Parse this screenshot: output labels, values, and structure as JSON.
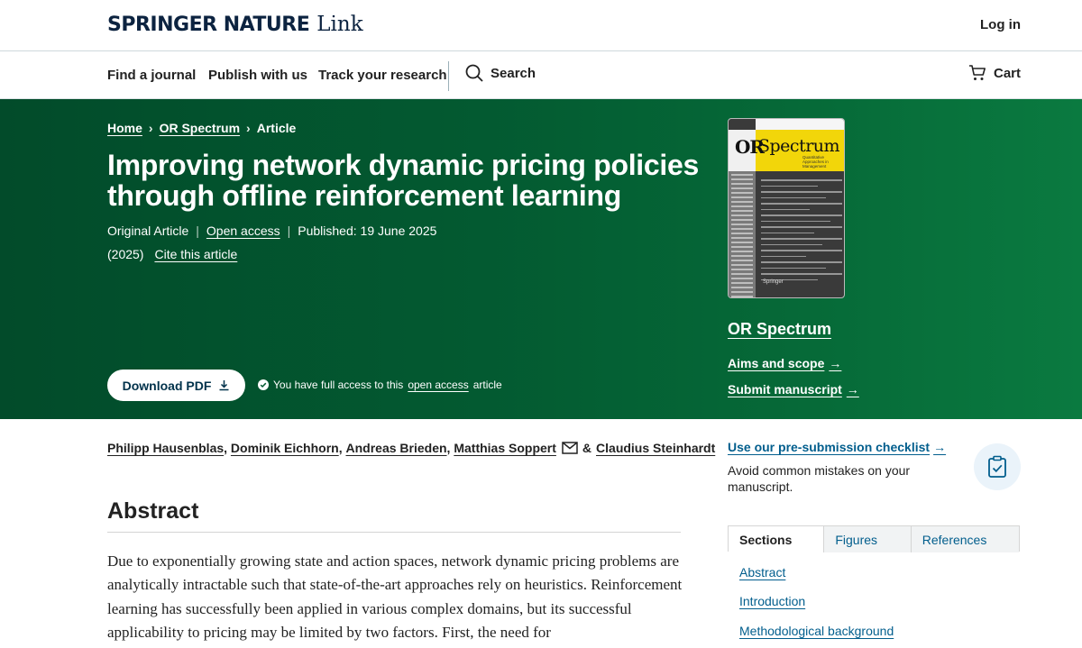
{
  "header": {
    "brand_main": "SPRINGER NATURE",
    "brand_link": "Link",
    "login": "Log in"
  },
  "nav": {
    "items": [
      "Find a journal",
      "Publish with us",
      "Track your research"
    ],
    "search": "Search",
    "cart": "Cart"
  },
  "breadcrumb": [
    "Home",
    "OR Spectrum",
    "Article"
  ],
  "article": {
    "title_line1": "Improving network dynamic pricing policies",
    "title_line2": "through offline reinforcement learning",
    "type": "Original Article",
    "access": "Open access",
    "published": "Published: 19 June 2025",
    "year": "(2025)",
    "cite": "Cite this article",
    "download": "Download PDF",
    "access_note_prefix": "You have full access to this",
    "access_note_link": "open access",
    "access_note_suffix": "article"
  },
  "journal": {
    "cover_or": "OR",
    "cover_spectrum": "Spectrum",
    "cover_sub": "Quantitative Approaches in Management",
    "cover_publisher": "Springer",
    "name": "OR Spectrum",
    "aims": "Aims and scope",
    "submit": "Submit manuscript"
  },
  "authors": [
    "Philipp Hausenblas",
    "Dominik Eichhorn",
    "Andreas Brieden",
    "Matthias Soppert",
    "Claudius Steinhardt"
  ],
  "authors_sep_amp": "&",
  "abstract": {
    "heading": "Abstract",
    "text": "Due to exponentially growing state and action spaces, network dynamic pricing problems are analytically intractable such that state-of-the-art approaches rely on heuristics. Reinforcement learning has successfully been applied in various complex domains, but its successful applicability to pricing may be limited by two factors. First, the need for"
  },
  "sidebar": {
    "checklist_link": "Use our pre-submission checklist",
    "checklist_desc": "Avoid common mistakes on your manuscript.",
    "tabs": [
      "Sections",
      "Figures",
      "References"
    ],
    "sections": [
      "Abstract",
      "Introduction",
      "Methodological background"
    ]
  },
  "colors": {
    "hero_green": "#035a31",
    "link_blue": "#025e8d",
    "brand_navy": "#0c2340",
    "cover_yellow": "#f2d60a"
  }
}
